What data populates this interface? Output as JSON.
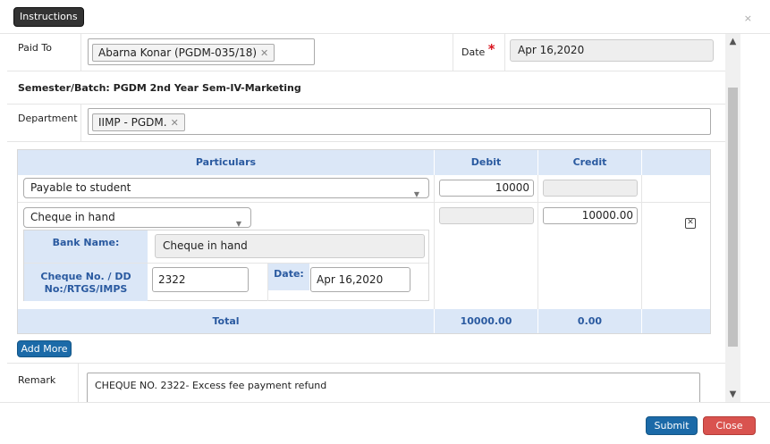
{
  "header": {
    "instructions_label": "Instructions",
    "close_glyph": "×"
  },
  "paid_to": {
    "label": "Paid To",
    "value": "Abarna Konar (PGDM-035/18)",
    "remove_glyph": "✕"
  },
  "date": {
    "label": "Date",
    "required_mark": "*",
    "value": "Apr 16,2020"
  },
  "semester": {
    "text": "Semester/Batch: PGDM 2nd Year Sem-IV-Marketing"
  },
  "department": {
    "label": "Department",
    "value": "IIMP - PGDM.",
    "remove_glyph": "✕"
  },
  "table": {
    "headers": {
      "particulars": "Particulars",
      "debit": "Debit",
      "credit": "Credit"
    },
    "row1": {
      "particular": "Payable to student",
      "debit": "10000",
      "credit": ""
    },
    "row2": {
      "particular": "Cheque in hand",
      "debit": "",
      "credit": "10000.00",
      "bank_name_label": "Bank Name:",
      "bank_name_value": "Cheque in hand",
      "cheque_label": "Cheque No. / DD No:/RTGS/IMPS",
      "cheque_value": "2322",
      "date_label": "Date:",
      "date_value": "Apr 16,2020"
    },
    "total": {
      "label": "Total",
      "debit": "10000.00",
      "credit": "0.00"
    }
  },
  "add_more_label": "Add More",
  "remark": {
    "label": "Remark",
    "value": "CHEQUE NO. 2322- Excess fee payment refund"
  },
  "footer": {
    "submit_label": "Submit",
    "close_label": "Close"
  },
  "colors": {
    "primary": "#1b6aa8",
    "danger": "#d9534f",
    "header_bg": "#dbe7f7",
    "header_text": "#2a5aa0"
  }
}
